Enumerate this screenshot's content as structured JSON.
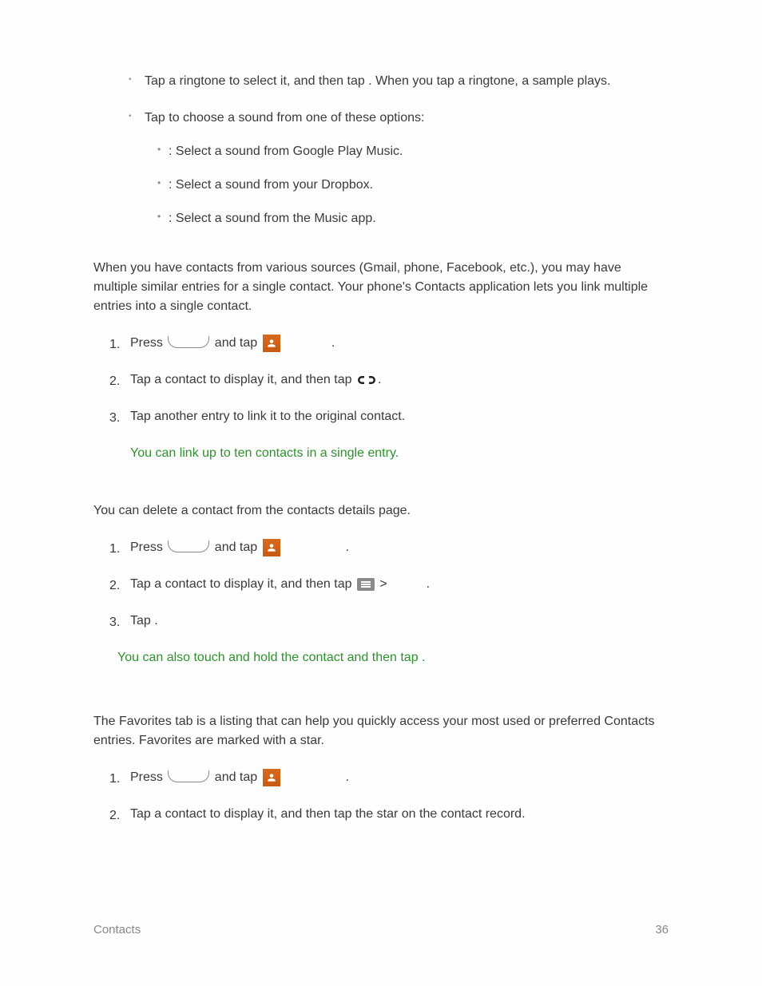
{
  "ringtone": {
    "item1_a": "Tap a ringtone to select it, and then tap ",
    "item1_b": ". When you tap a ringtone, a sample plays.",
    "item2_a": "Tap ",
    "item2_b": " to choose a sound from one of these options:",
    "sub1": ": Select a sound from Google Play Music.",
    "sub2": ": Select a sound from your Dropbox.",
    "sub3": ": Select a sound from the Music app."
  },
  "link_section": {
    "intro": "When you have contacts from various sources (Gmail, phone, Facebook, etc.), you may have multiple similar entries for a single contact. Your phone's Contacts application lets you link multiple entries into a single contact.",
    "s1a": "Press ",
    "s1b": " and tap ",
    "s1c": " ",
    "s1d": ".",
    "s2a": "Tap a contact to display it, and then tap ",
    "s2b": ".",
    "s3": "Tap another entry to link it to the original contact.",
    "note": "You can link up to ten contacts in a single entry."
  },
  "delete_section": {
    "intro": "You can delete a contact from the contacts details page.",
    "s1a": "Press ",
    "s1b": " and tap ",
    "s1c": " ",
    "s1d": ".",
    "s2a": "Tap a contact to display it, and then tap ",
    "s2b": " > ",
    "s2c": ".",
    "s3a": "Tap ",
    "s3b": ".",
    "note_a": "You can also touch and hold the contact and then tap ",
    "note_b": "."
  },
  "favorites_section": {
    "intro": "The Favorites tab is a listing that can help you quickly access your most used or preferred Contacts entries. Favorites are marked with a star.",
    "s1a": "Press ",
    "s1b": " and tap ",
    "s1c": " ",
    "s1d": ".",
    "s2": "Tap a contact to display it, and then tap the star on the contact record."
  },
  "footer": {
    "section": "Contacts",
    "page": "36"
  }
}
